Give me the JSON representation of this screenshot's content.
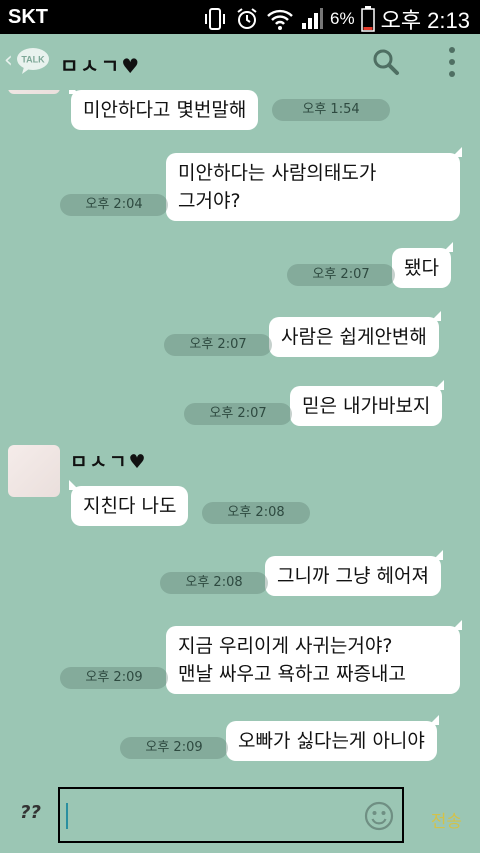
{
  "status_bar": {
    "carrier": "SKT",
    "battery": "6%",
    "time": "오후 2:13"
  },
  "header": {
    "title": "ㅁㅅㄱ♥",
    "logo_text": "TALK",
    "back_icon": "chevron-left-icon"
  },
  "messages": [
    {
      "side": "left",
      "text": "미안하다고 몇번말해",
      "time": "오후 1:54"
    },
    {
      "side": "right",
      "text": "미안하다는 사람의태도가\n그거야?",
      "time": "오후 2:04"
    },
    {
      "side": "right",
      "text": "됐다",
      "time": "오후 2:07"
    },
    {
      "side": "right",
      "text": "사람은 쉽게안변해",
      "time": "오후 2:07"
    },
    {
      "side": "right",
      "text": "믿은 내가바보지",
      "time": "오후 2:07"
    },
    {
      "side": "left",
      "sender": "ㅁㅅㄱ♥",
      "text": "지친다 나도",
      "time": "오후 2:08"
    },
    {
      "side": "right",
      "text": "그니까 그냥 헤어져",
      "time": "오후 2:08"
    },
    {
      "side": "right",
      "text": "지금 우리이게 사귀는거야?\n맨날 싸우고 욕하고 짜증내고",
      "time": "오후 2:09"
    },
    {
      "side": "right",
      "text": "오빠가 싫다는게 아니야",
      "time": "오후 2:09"
    }
  ],
  "input": {
    "attach_label": "??",
    "send_label": "전송",
    "value": ""
  },
  "colors": {
    "background": "#9bc6b4",
    "bubble": "#ffffff",
    "send": "#d2c24b"
  }
}
